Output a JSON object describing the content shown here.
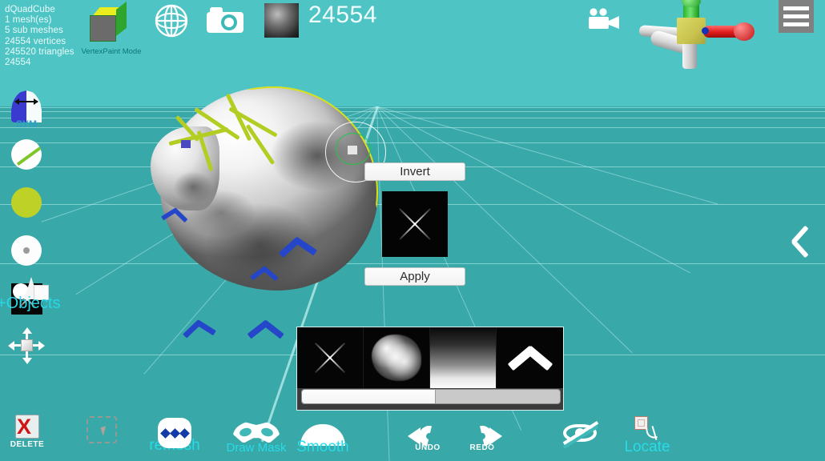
{
  "app": {
    "mode_label": "VertexPaint  Mode",
    "poly_count": "24554"
  },
  "stats_panel": {
    "lines": [
      "dQuadCube",
      "1 mesh(es)",
      "5 sub meshes",
      "24554 vertices",
      "245520 triangles",
      "24554"
    ],
    "text": "dQuadCube\n1 mesh(es)\n5 sub meshes\n24554 vertices\n245520 triangles\n24554"
  },
  "header": {
    "icons": [
      {
        "name": "cube-mode-icon",
        "label": "VertexPaint  Mode"
      },
      {
        "name": "globe-icon",
        "label": ""
      },
      {
        "name": "camera-icon",
        "label": ""
      },
      {
        "name": "material-sphere-thumbnail",
        "label": ""
      },
      {
        "name": "video-camera-icon",
        "label": ""
      },
      {
        "name": "transform-gizmo",
        "label": ""
      },
      {
        "name": "hamburger-menu-icon",
        "label": ""
      }
    ]
  },
  "sidebar": {
    "items": [
      {
        "name": "symmetry-toggle",
        "label": "SYM"
      },
      {
        "name": "brush-preview",
        "label": ""
      },
      {
        "name": "color-swatch",
        "label": "",
        "color": "#bed127"
      },
      {
        "name": "falloff-preview",
        "label": ""
      },
      {
        "name": "alpha-texture",
        "label": ""
      },
      {
        "name": "move-gizmo-toggle",
        "label": ""
      },
      {
        "name": "add-objects",
        "label": "+Objects"
      }
    ]
  },
  "mask_panel": {
    "invert_label": "Invert",
    "apply_label": "Apply",
    "preview_icon": "x-mask-icon"
  },
  "brush_panel": {
    "cells": [
      {
        "name": "brush-alpha-x",
        "icon": "x-mask-icon"
      },
      {
        "name": "brush-alpha-splat",
        "icon": "splat-icon"
      },
      {
        "name": "brush-alpha-gradient",
        "icon": "gradient-icon"
      },
      {
        "name": "brush-collapse",
        "icon": "chevron-up-icon"
      }
    ],
    "slider": {
      "name": "brush-strength-slider",
      "value_percent": 52
    }
  },
  "toolbar": {
    "items": [
      {
        "name": "delete-button",
        "label": "DELETE",
        "style": "tiny"
      },
      {
        "name": "select-button",
        "label": "",
        "style": "small"
      },
      {
        "name": "remesh-button",
        "label": "remesh",
        "style": "big"
      },
      {
        "name": "draw-mask-button",
        "label": "Draw Mask",
        "style": "small"
      },
      {
        "name": "smooth-button",
        "label": "Smooth",
        "style": "big"
      },
      {
        "name": "undo-button",
        "label": "UNDO",
        "style": "tiny"
      },
      {
        "name": "redo-button",
        "label": "REDO",
        "style": "tiny"
      },
      {
        "name": "hide-button",
        "label": "",
        "style": "small"
      },
      {
        "name": "locate-button",
        "label": "Locate",
        "style": "big"
      }
    ]
  },
  "viewport": {
    "edge_chevron": "chevron-left-icon",
    "sky_color": "#4ec4c4",
    "floor_color": "#38a8a8",
    "accent_color": "#29dbe8"
  }
}
